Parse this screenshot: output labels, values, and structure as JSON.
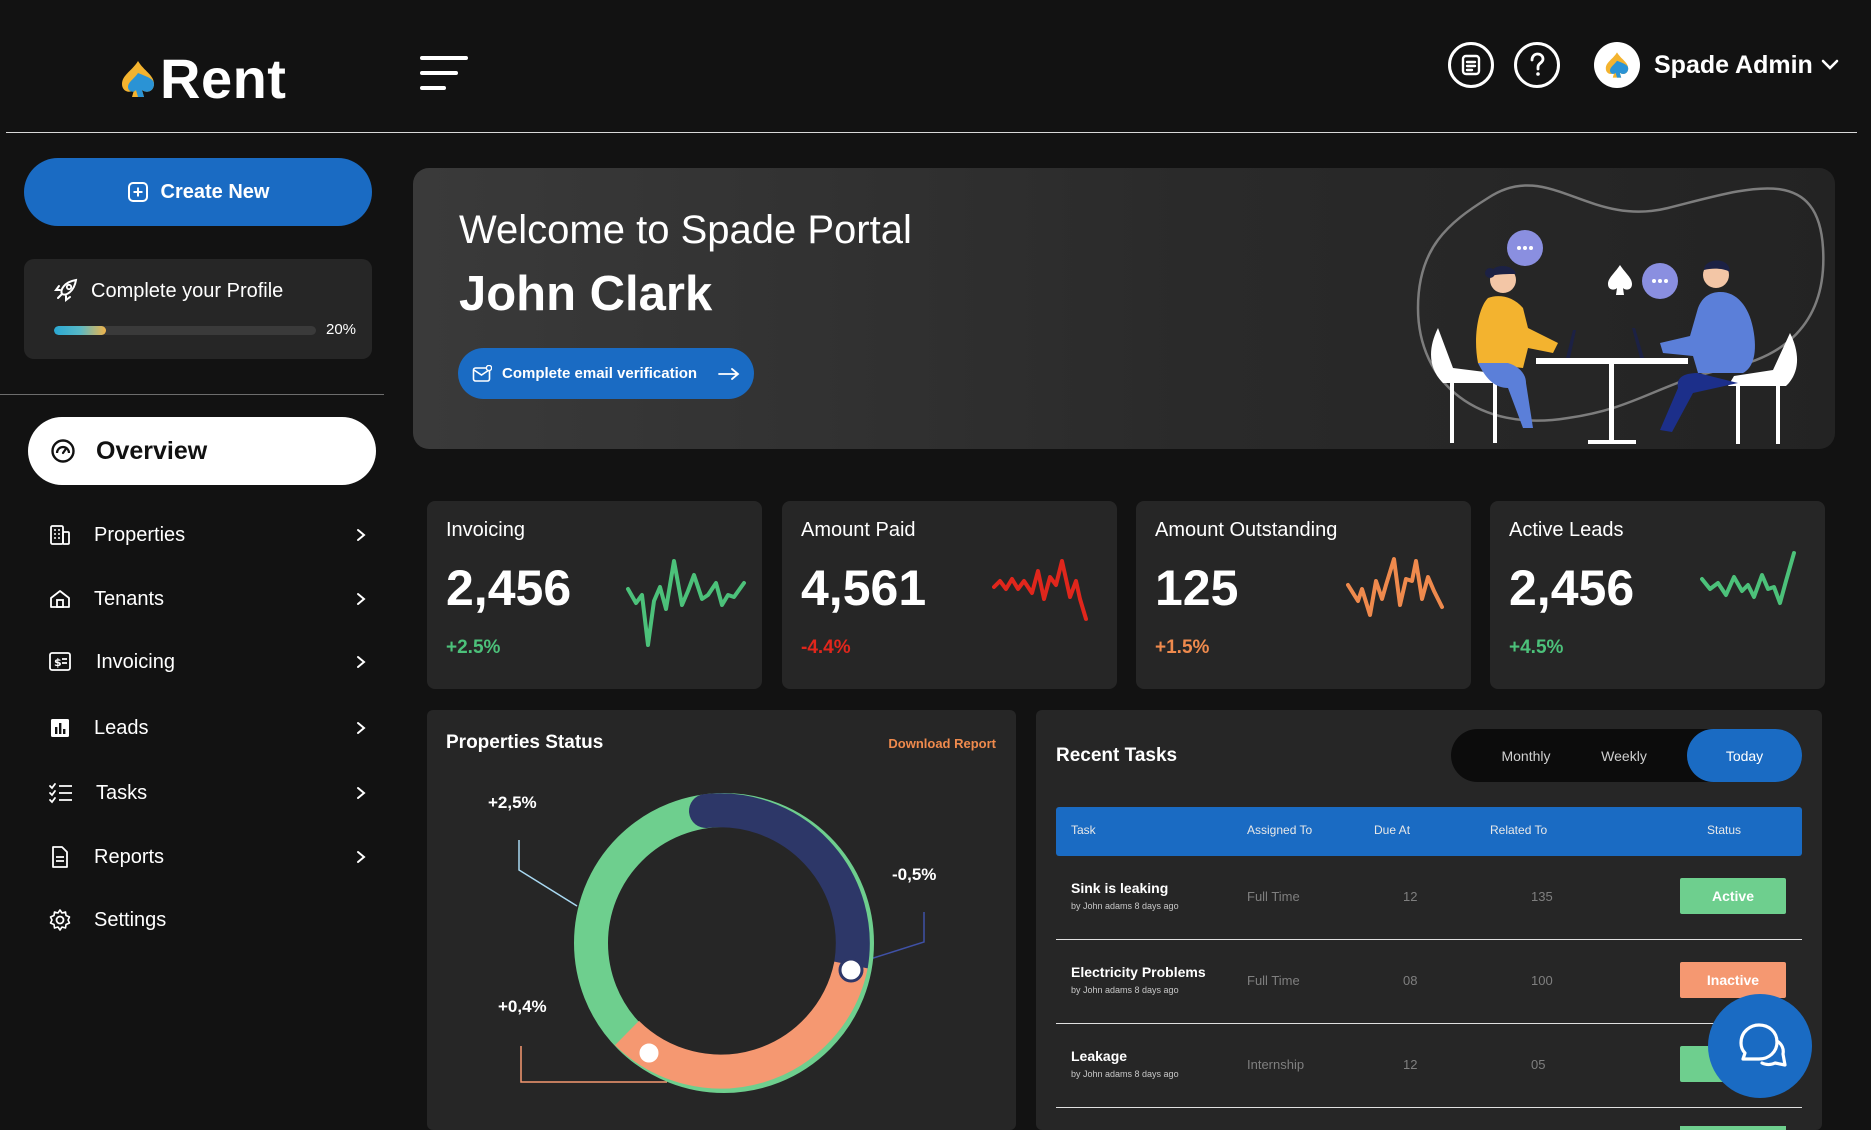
{
  "app": {
    "logo_text": "Rent"
  },
  "header": {
    "user_name": "Spade Admin"
  },
  "sidebar": {
    "create_label": "Create New",
    "profile": {
      "title": "Complete your Profile",
      "percent_label": "20%",
      "progress": 0.2
    },
    "active_item": "Overview",
    "items": [
      {
        "label": "Properties",
        "icon": "building-icon",
        "has_chevron": true
      },
      {
        "label": "Tenants",
        "icon": "house-icon",
        "has_chevron": true
      },
      {
        "label": "Invoicing",
        "icon": "invoice-icon",
        "has_chevron": true
      },
      {
        "label": "Leads",
        "icon": "bar-chart-icon",
        "has_chevron": true
      },
      {
        "label": "Tasks",
        "icon": "checklist-icon",
        "has_chevron": true
      },
      {
        "label": "Reports",
        "icon": "document-icon",
        "has_chevron": true
      },
      {
        "label": "Settings",
        "icon": "gear-icon",
        "has_chevron": false
      }
    ]
  },
  "banner": {
    "welcome": "Welcome to Spade Portal",
    "name": "John Clark",
    "verify_label": "Complete email verification"
  },
  "stats": [
    {
      "title": "Invoicing",
      "value": "2,456",
      "change": "+2.5%",
      "color": "#4cc17a"
    },
    {
      "title": "Amount Paid",
      "value": "4,561",
      "change": "-4.4%",
      "color": "#e0261c"
    },
    {
      "title": "Amount Outstanding",
      "value": "125",
      "change": "+1.5%",
      "color": "#ef8a4d"
    },
    {
      "title": "Active Leads",
      "value": "2,456",
      "change": "+4.5%",
      "color": "#4cc17a"
    }
  ],
  "properties_status": {
    "title": "Properties Status",
    "download_label": "Download Report",
    "labels": {
      "top_left": "+2,5%",
      "right": "-0,5%",
      "bottom_left": "+0,4%"
    },
    "segment_colors": {
      "green": "#6ecf8e",
      "navy": "#2d3768",
      "orange": "#f59871"
    }
  },
  "recent_tasks": {
    "title": "Recent Tasks",
    "tabs": [
      "Monthly",
      "Weekly",
      "Today"
    ],
    "active_tab": "Today",
    "columns": [
      "Task",
      "Assigned To",
      "Due At",
      "Related To",
      "Status"
    ],
    "rows": [
      {
        "task": "Sink is leaking",
        "sub": "by John adams 8 days ago",
        "assigned": "Full Time",
        "due": "12",
        "related": "135",
        "status": "Active",
        "status_color": "#6ecf8e"
      },
      {
        "task": "Electricity Problems",
        "sub": "by John adams 8 days ago",
        "assigned": "Full Time",
        "due": "08",
        "related": "100",
        "status": "Inactive",
        "status_color": "#f59871"
      },
      {
        "task": "Leakage",
        "sub": "by John adams 8 days ago",
        "assigned": "Internship",
        "due": "12",
        "related": "05",
        "status": "",
        "status_color": "#6ecf8e"
      }
    ]
  }
}
